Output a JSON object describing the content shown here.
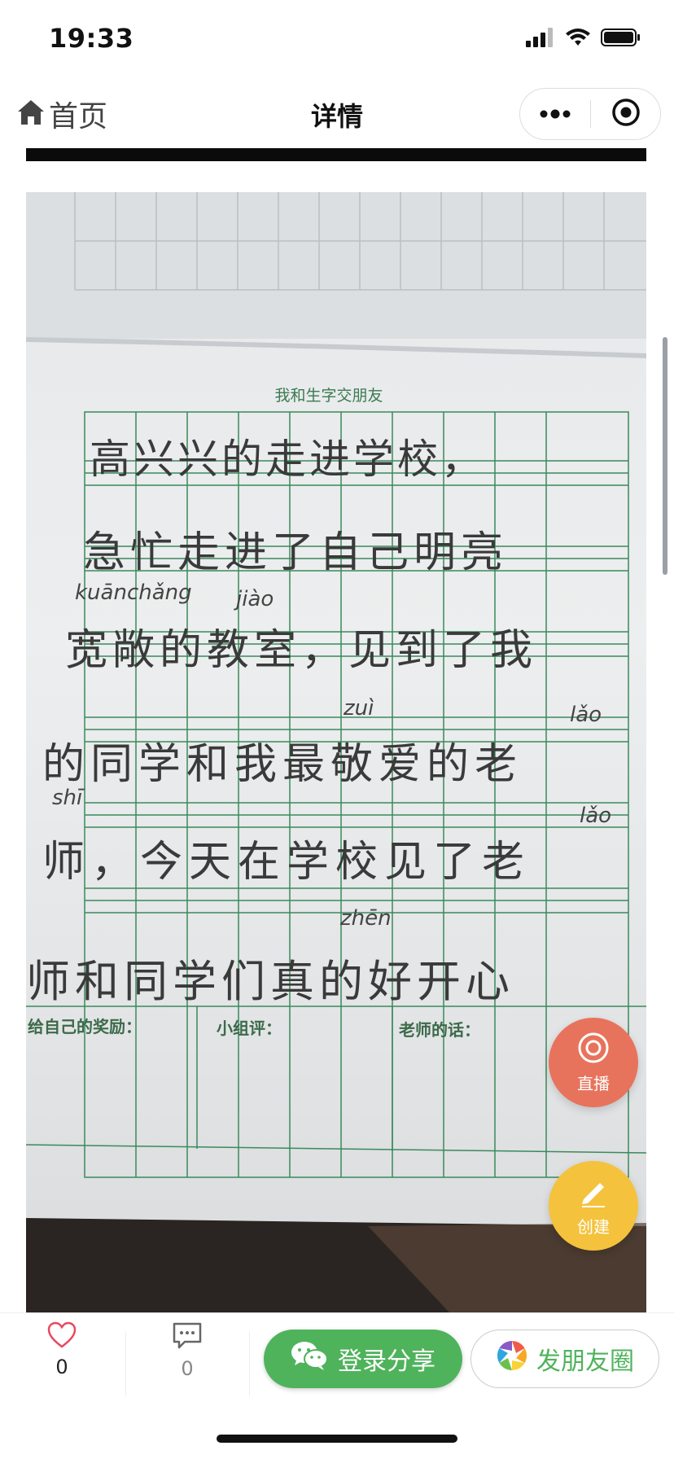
{
  "status_bar": {
    "time": "19:33"
  },
  "nav": {
    "home_label": "首页",
    "title": "详情"
  },
  "photo": {
    "header": "我和生字交朋友",
    "lines": [
      "高兴兴的走进学校，",
      "急忙走进了自己明亮",
      "宽敞的教室，见到了我",
      "的同学和我最敬爱的老",
      "师，今天在学校见了老",
      "师和同学们真的好开心"
    ],
    "pinyin": [
      "kuānchǎng",
      "jiào",
      "zuì",
      "lǎo",
      "shī",
      "lǎo",
      "zhēn"
    ],
    "footer": {
      "reward": "给自己的奖励：",
      "group": "小组评：",
      "teacher": "老师的话："
    }
  },
  "fab": {
    "live_label": "直播",
    "create_label": "创建"
  },
  "bottom_bar": {
    "like_count": "0",
    "comment_count": "0",
    "share_label": "登录分享",
    "moments_label": "发朋友圈"
  },
  "colors": {
    "accent_green": "#4fb35c",
    "live_red": "#e8735c",
    "create_yellow": "#f4c23c",
    "grid_green": "#3a8a5c"
  }
}
